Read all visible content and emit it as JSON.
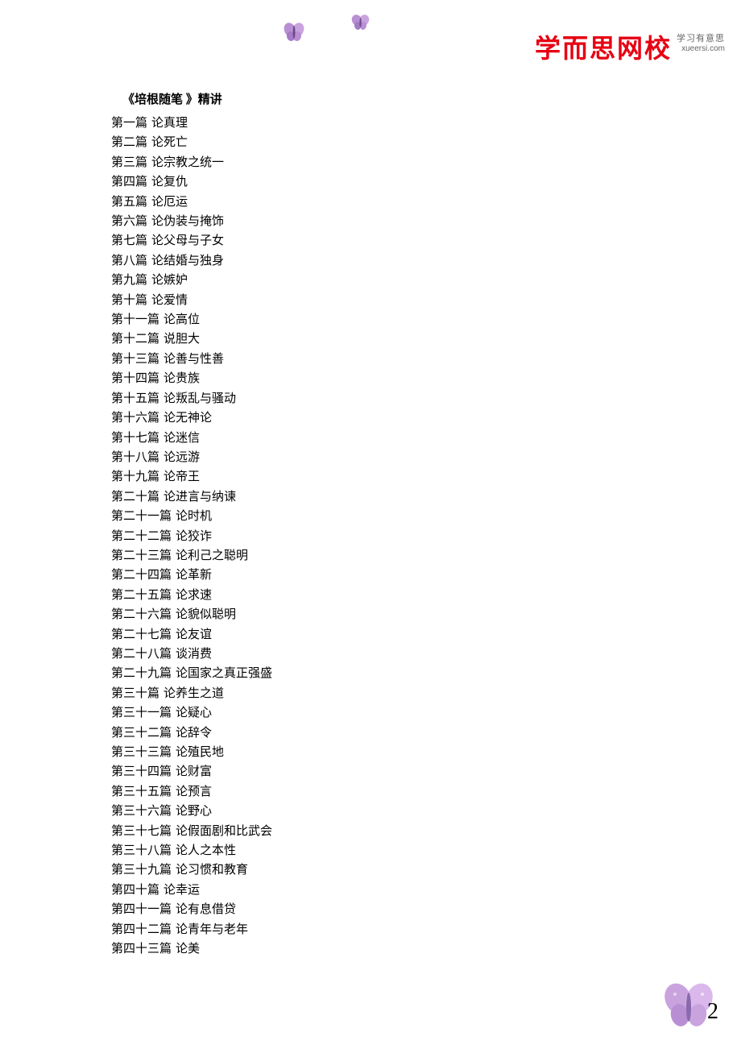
{
  "logo": {
    "main": "学而思网校",
    "tagline": "学习有意思",
    "url": "xueersi.com"
  },
  "title": "《培根随笔 》精讲",
  "toc": [
    {
      "chapter": "第一篇",
      "title": "论真理"
    },
    {
      "chapter": "第二篇",
      "title": "论死亡"
    },
    {
      "chapter": "第三篇",
      "title": "论宗教之统一"
    },
    {
      "chapter": "第四篇",
      "title": "论复仇"
    },
    {
      "chapter": "第五篇",
      "title": "论厄运"
    },
    {
      "chapter": "第六篇",
      "title": "论伪装与掩饰"
    },
    {
      "chapter": "第七篇",
      "title": "论父母与子女"
    },
    {
      "chapter": "第八篇",
      "title": "论结婚与独身"
    },
    {
      "chapter": "第九篇",
      "title": "论嫉妒"
    },
    {
      "chapter": "第十篇",
      "title": "论爱情"
    },
    {
      "chapter": "第十一篇",
      "title": "论高位"
    },
    {
      "chapter": "第十二篇",
      "title": "说胆大"
    },
    {
      "chapter": "第十三篇",
      "title": "论善与性善"
    },
    {
      "chapter": "第十四篇",
      "title": "论贵族"
    },
    {
      "chapter": "第十五篇",
      "title": "论叛乱与骚动"
    },
    {
      "chapter": "第十六篇",
      "title": "论无神论"
    },
    {
      "chapter": "第十七篇",
      "title": "论迷信"
    },
    {
      "chapter": "第十八篇",
      "title": "论远游"
    },
    {
      "chapter": "第十九篇",
      "title": "论帝王"
    },
    {
      "chapter": "第二十篇",
      "title": "论进言与纳谏"
    },
    {
      "chapter": "第二十一篇",
      "title": "论时机"
    },
    {
      "chapter": "第二十二篇",
      "title": "论狡诈"
    },
    {
      "chapter": "第二十三篇",
      "title": "论利己之聪明"
    },
    {
      "chapter": "第二十四篇",
      "title": "论革新"
    },
    {
      "chapter": "第二十五篇",
      "title": "论求速"
    },
    {
      "chapter": "第二十六篇",
      "title": "论貌似聪明"
    },
    {
      "chapter": "第二十七篇",
      "title": "论友谊"
    },
    {
      "chapter": "第二十八篇",
      "title": "谈消费"
    },
    {
      "chapter": "第二十九篇",
      "title": "论国家之真正强盛"
    },
    {
      "chapter": "第三十篇",
      "title": "论养生之道"
    },
    {
      "chapter": "第三十一篇",
      "title": "论疑心"
    },
    {
      "chapter": "第三十二篇",
      "title": "论辞令"
    },
    {
      "chapter": "第三十三篇",
      "title": "论殖民地"
    },
    {
      "chapter": "第三十四篇",
      "title": "论财富"
    },
    {
      "chapter": "第三十五篇",
      "title": "论预言"
    },
    {
      "chapter": "第三十六篇",
      "title": "论野心"
    },
    {
      "chapter": "第三十七篇",
      "title": "论假面剧和比武会"
    },
    {
      "chapter": "第三十八篇",
      "title": "论人之本性"
    },
    {
      "chapter": "第三十九篇",
      "title": "论习惯和教育"
    },
    {
      "chapter": "第四十篇",
      "title": "论幸运"
    },
    {
      "chapter": "第四十一篇",
      "title": "论有息借贷"
    },
    {
      "chapter": "第四十二篇",
      "title": "论青年与老年"
    },
    {
      "chapter": "第四十三篇",
      "title": "论美"
    }
  ],
  "page_number": "2"
}
